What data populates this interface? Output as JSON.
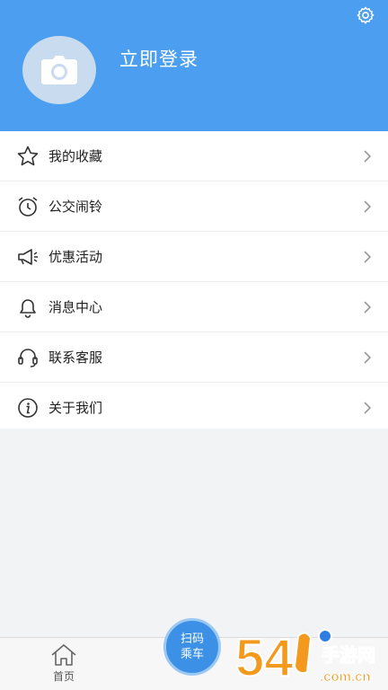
{
  "header": {
    "login_label": "立即登录",
    "settings_icon": "gear-icon",
    "avatar_icon": "camera-icon",
    "background_color": "#4c9ff0"
  },
  "menu": {
    "items": [
      {
        "label": "我的收藏",
        "icon": "star-icon"
      },
      {
        "label": "公交闹铃",
        "icon": "alarm-clock-icon"
      },
      {
        "label": "优惠活动",
        "icon": "megaphone-icon"
      },
      {
        "label": "消息中心",
        "icon": "bell-icon"
      },
      {
        "label": "联系客服",
        "icon": "headset-icon"
      },
      {
        "label": "关于我们",
        "icon": "info-icon"
      }
    ]
  },
  "tabbar": {
    "home_label": "首页",
    "scan_line1": "扫码",
    "scan_line2": "乘车"
  },
  "watermark": {
    "brand_number": "54",
    "brand_text": "手游网",
    "domain": ".com.cn"
  },
  "colors": {
    "accent": "#4c9ff0",
    "scan_button": "#3c90e6",
    "watermark_orange": "#f39a1e"
  }
}
